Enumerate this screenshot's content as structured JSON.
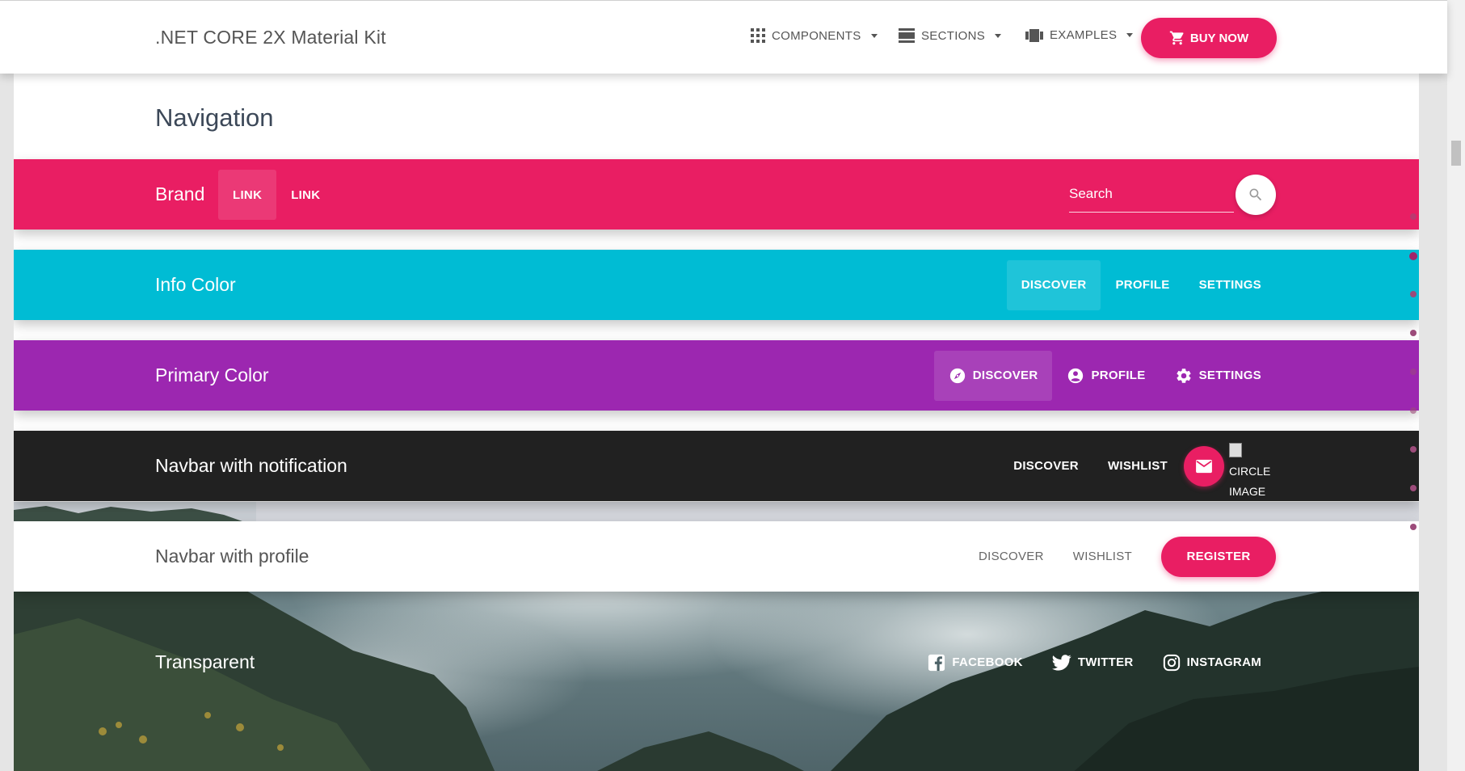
{
  "header": {
    "brand": ".NET CORE 2X Material Kit",
    "nav": [
      {
        "label": "COMPONENTS"
      },
      {
        "label": "SECTIONS"
      },
      {
        "label": "EXAMPLES"
      }
    ],
    "buy_label": "BUY NOW"
  },
  "section": {
    "title": "Navigation"
  },
  "navbars": {
    "rose": {
      "brand": "Brand",
      "link1": "LINK",
      "link2": "LINK",
      "search_placeholder": "Search",
      "color": "#e91e63"
    },
    "info": {
      "brand": "Info Color",
      "links": [
        "DISCOVER",
        "PROFILE",
        "SETTINGS"
      ],
      "color": "#00bcd4"
    },
    "primary": {
      "brand": "Primary Color",
      "links": [
        "DISCOVER",
        "PROFILE",
        "SETTINGS"
      ],
      "color": "#9c27b0"
    },
    "notification": {
      "brand": "Navbar with notification",
      "links": [
        "DISCOVER",
        "WISHLIST"
      ],
      "image_alt": "CIRCLE IMAGE",
      "color": "#212121"
    },
    "profile": {
      "brand": "Navbar with profile",
      "links": [
        "DISCOVER",
        "WISHLIST"
      ],
      "register_label": "REGISTER"
    },
    "transparent": {
      "brand": "Transparent",
      "links": [
        "FACEBOOK",
        "TWITTER",
        "INSTAGRAM"
      ]
    }
  },
  "colors": {
    "accent": "#e91e63",
    "info": "#00bcd4",
    "primary": "#9c27b0",
    "dark": "#212121"
  }
}
